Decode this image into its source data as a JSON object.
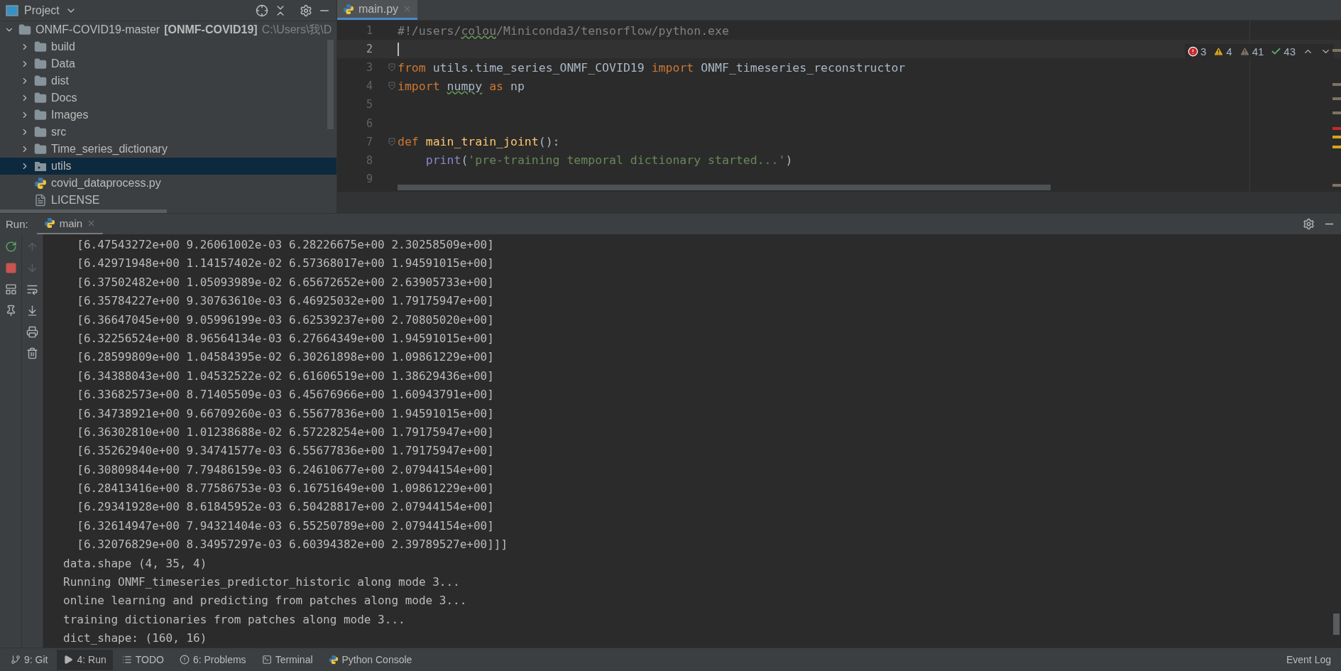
{
  "project": {
    "title": "Project",
    "root": {
      "name": "ONMF-COVID19-master",
      "module": "[ONMF-COVID19]",
      "path": "C:\\Users\\我\\D",
      "expanded": true,
      "selected": false,
      "children": [
        {
          "name": "build",
          "kind": "folder",
          "expanded": false,
          "selected": false
        },
        {
          "name": "Data",
          "kind": "folder",
          "expanded": false,
          "selected": false
        },
        {
          "name": "dist",
          "kind": "folder",
          "expanded": false,
          "selected": false
        },
        {
          "name": "Docs",
          "kind": "folder",
          "expanded": false,
          "selected": false
        },
        {
          "name": "Images",
          "kind": "folder",
          "expanded": false,
          "selected": false
        },
        {
          "name": "src",
          "kind": "folder",
          "expanded": false,
          "selected": false
        },
        {
          "name": "Time_series_dictionary",
          "kind": "folder",
          "expanded": false,
          "selected": false
        },
        {
          "name": "utils",
          "kind": "package",
          "expanded": false,
          "selected": true
        },
        {
          "name": "covid_dataprocess.py",
          "kind": "python",
          "selected": false
        },
        {
          "name": "LICENSE",
          "kind": "text",
          "selected": false
        }
      ]
    }
  },
  "editor": {
    "tabs": [
      {
        "label": "main.py",
        "selected": true
      }
    ],
    "problems": [
      {
        "kind": "error",
        "count": "3"
      },
      {
        "kind": "warning",
        "count": "4"
      },
      {
        "kind": "weak",
        "count": "41"
      },
      {
        "kind": "typo",
        "count": "43"
      }
    ],
    "lines": [
      {
        "number": "1",
        "current": false,
        "fold": false,
        "tokens": [
          {
            "text": "#!/users/",
            "kind": "comment"
          },
          {
            "text": "colou",
            "kind": "comment_typo"
          },
          {
            "text": "/Miniconda3/tensorflow/python.exe",
            "kind": "comment"
          }
        ]
      },
      {
        "number": "2",
        "current": true,
        "fold": false
      },
      {
        "number": "3",
        "current": false,
        "fold": true,
        "tokens": [
          {
            "text": "from",
            "kind": "keyword"
          },
          {
            "text": " utils.time_series_ONMF_COVID19 ",
            "kind": "plain"
          },
          {
            "text": "import",
            "kind": "keyword"
          },
          {
            "text": " ONMF_timeseries_reconstructor",
            "kind": "plain"
          }
        ]
      },
      {
        "number": "4",
        "current": false,
        "fold": true,
        "tokens": [
          {
            "text": "import ",
            "kind": "keyword"
          },
          {
            "text": "numpy",
            "kind": "plain_typo"
          },
          {
            "text": " as ",
            "kind": "keyword"
          },
          {
            "text": "np",
            "kind": "plain"
          }
        ]
      },
      {
        "number": "5",
        "current": false,
        "fold": false
      },
      {
        "number": "6",
        "current": false,
        "fold": false
      },
      {
        "number": "7",
        "current": false,
        "fold": true,
        "tokens": [
          {
            "text": "def ",
            "kind": "keyword"
          },
          {
            "text": "main_train_joint",
            "kind": "func"
          },
          {
            "text": "():",
            "kind": "plain"
          }
        ]
      },
      {
        "number": "8",
        "current": false,
        "fold": false,
        "tokens": [
          {
            "text": "    print",
            "kind": "builtin"
          },
          {
            "text": "(",
            "kind": "plain"
          },
          {
            "text": "'pre-training temporal dictionary started...'",
            "kind": "string"
          },
          {
            "text": ")",
            "kind": "plain"
          }
        ]
      },
      {
        "number": "9",
        "current": false,
        "fold": false
      }
    ]
  },
  "run": {
    "label": "Run:",
    "tabs": [
      {
        "label": "main",
        "selected": true
      }
    ],
    "tools": [
      {
        "kind": "rerun"
      },
      {
        "kind": "stop"
      },
      {
        "kind": "layout"
      },
      {
        "kind": "pin"
      }
    ],
    "actions": [
      {
        "kind": "up",
        "disabled": true
      },
      {
        "kind": "down",
        "disabled": true
      },
      {
        "kind": "wrap",
        "disabled": false
      },
      {
        "kind": "scroll_end",
        "disabled": false
      },
      {
        "kind": "print",
        "disabled": false
      },
      {
        "kind": "clear",
        "disabled": false
      }
    ],
    "output": [
      "  [6.47543272e+00 9.26061002e-03 6.28226675e+00 2.30258509e+00]",
      "  [6.42971948e+00 1.14157402e-02 6.57368017e+00 1.94591015e+00]",
      "  [6.37502482e+00 1.05093989e-02 6.65672652e+00 2.63905733e+00]",
      "  [6.35784227e+00 9.30763610e-03 6.46925032e+00 1.79175947e+00]",
      "  [6.36647045e+00 9.05996199e-03 6.62539237e+00 2.70805020e+00]",
      "  [6.32256524e+00 8.96564134e-03 6.27664349e+00 1.94591015e+00]",
      "  [6.28599809e+00 1.04584395e-02 6.30261898e+00 1.09861229e+00]",
      "  [6.34388043e+00 1.04532522e-02 6.61606519e+00 1.38629436e+00]",
      "  [6.33682573e+00 8.71405509e-03 6.45676966e+00 1.60943791e+00]",
      "  [6.34738921e+00 9.66709260e-03 6.55677836e+00 1.94591015e+00]",
      "  [6.36302810e+00 1.01238688e-02 6.57228254e+00 1.79175947e+00]",
      "  [6.35262940e+00 9.34741577e-03 6.55677836e+00 1.79175947e+00]",
      "  [6.30809844e+00 7.79486159e-03 6.24610677e+00 2.07944154e+00]",
      "  [6.28413416e+00 8.77586753e-03 6.16751649e+00 1.09861229e+00]",
      "  [6.29341928e+00 8.61845952e-03 6.50428817e+00 2.07944154e+00]",
      "  [6.32614947e+00 7.94321404e-03 6.55250789e+00 2.07944154e+00]",
      "  [6.32076829e+00 8.34957297e-03 6.60394382e+00 2.39789527e+00]]]",
      "data.shape (4, 35, 4)",
      "Running ONMF_timeseries_predictor_historic along mode 3...",
      "online learning and predicting from patches along mode 3...",
      "training dictionaries from patches along mode 3...",
      "dict_shape: (160, 16)"
    ]
  },
  "status_bar": {
    "tabs": [
      {
        "label": "9: Git",
        "kind": "git",
        "selected": false
      },
      {
        "label": "4: Run",
        "kind": "run",
        "selected": true
      },
      {
        "label": "TODO",
        "kind": "todo",
        "selected": false
      },
      {
        "label": "6: Problems",
        "kind": "problems",
        "selected": false
      },
      {
        "label": "Terminal",
        "kind": "terminal",
        "selected": false
      },
      {
        "label": "Python Console",
        "kind": "console",
        "selected": false
      }
    ],
    "right": "Event Log"
  }
}
